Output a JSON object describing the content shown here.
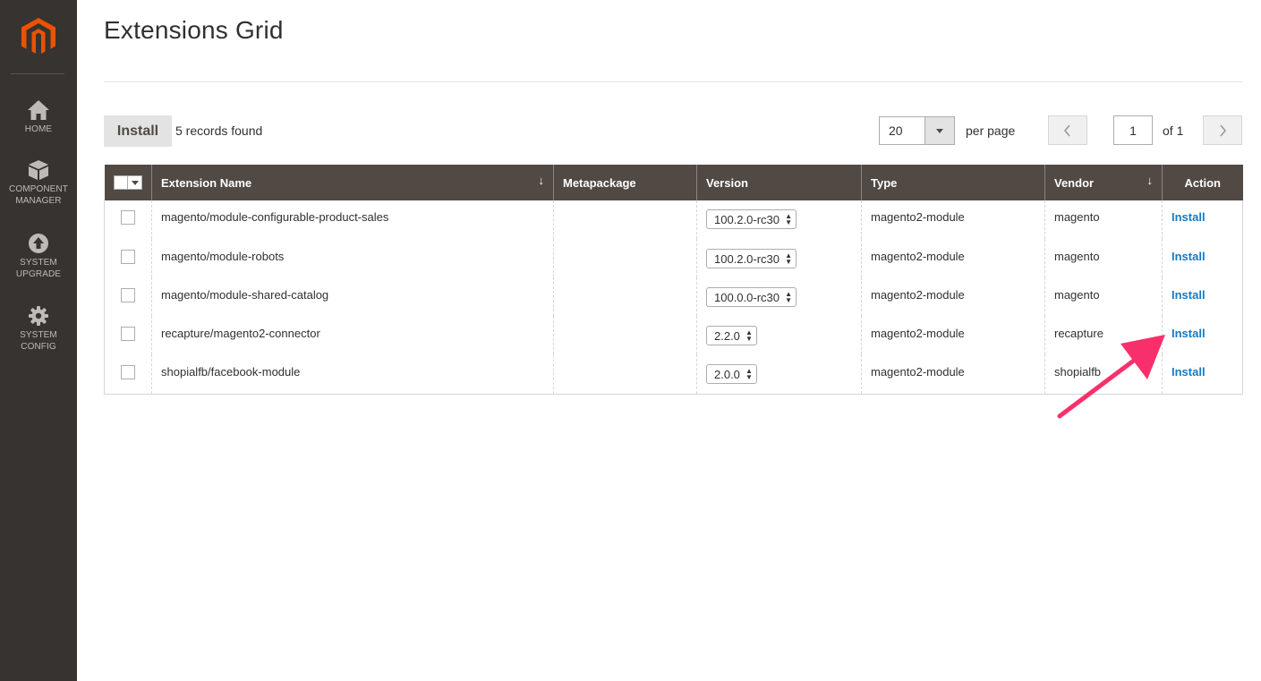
{
  "sidebar": {
    "items": [
      {
        "label": "HOME",
        "icon": "home-icon"
      },
      {
        "label": "COMPONENT MANAGER",
        "icon": "cube-icon"
      },
      {
        "label": "SYSTEM UPGRADE",
        "icon": "upload-icon"
      },
      {
        "label": "SYSTEM CONFIG",
        "icon": "gear-icon"
      }
    ]
  },
  "page": {
    "title": "Extensions Grid"
  },
  "toolbar": {
    "install_label": "Install",
    "records_text": "5 records found",
    "per_page_value": "20",
    "per_page_label": "per page",
    "page_value": "1",
    "of_label": "of 1"
  },
  "table": {
    "headers": [
      "Extension Name",
      "Metapackage",
      "Version",
      "Type",
      "Vendor",
      "Action"
    ],
    "sort_glyph": "↓",
    "rows": [
      {
        "name": "magento/module-configurable-product-sales",
        "metapackage": "",
        "version": "100.2.0-rc30",
        "type": "magento2-module",
        "vendor": "magento",
        "action": "Install"
      },
      {
        "name": "magento/module-robots",
        "metapackage": "",
        "version": "100.2.0-rc30",
        "type": "magento2-module",
        "vendor": "magento",
        "action": "Install"
      },
      {
        "name": "magento/module-shared-catalog",
        "metapackage": "",
        "version": "100.0.0-rc30",
        "type": "magento2-module",
        "vendor": "magento",
        "action": "Install"
      },
      {
        "name": "recapture/magento2-connector",
        "metapackage": "",
        "version": "2.2.0",
        "type": "magento2-module",
        "vendor": "recapture",
        "action": "Install"
      },
      {
        "name": "shopialfb/facebook-module",
        "metapackage": "",
        "version": "2.0.0",
        "type": "magento2-module",
        "vendor": "shopialfb",
        "action": "Install"
      }
    ]
  },
  "colors": {
    "sidebar_bg": "#373330",
    "header_bg": "#514943",
    "link": "#1979c3",
    "logo": "#eb5202",
    "annotation_arrow": "#f7306b"
  }
}
